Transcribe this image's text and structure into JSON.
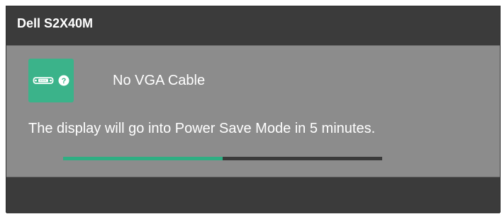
{
  "window": {
    "title": "Dell S2X40M"
  },
  "status": {
    "icon": "vga-connector-icon",
    "secondary_icon": "question-mark-icon",
    "question_glyph": "?",
    "message": "No VGA Cable"
  },
  "info": {
    "message": "The display will go into Power Save Mode in 5 minutes."
  },
  "progress": {
    "fraction": 0.5
  },
  "colors": {
    "title_bar": "#3b3b3b",
    "panel": "#8c8c8c",
    "icon_box": "#3bb38a",
    "progress_fill": "#2fae83",
    "progress_track": "#3a3a3a",
    "text": "#ffffff"
  }
}
